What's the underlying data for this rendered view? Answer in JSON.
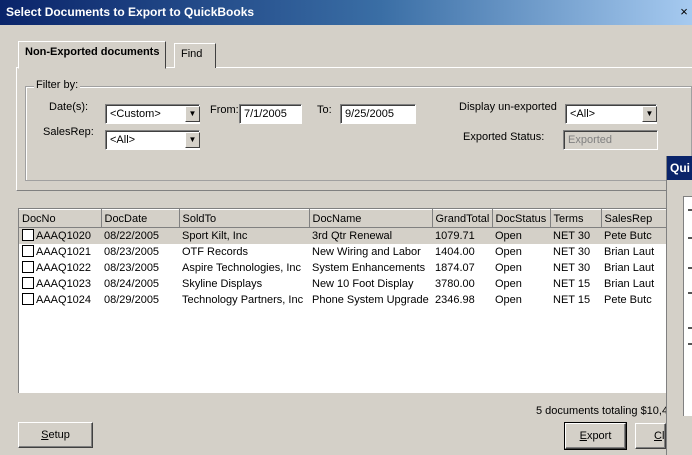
{
  "window": {
    "title": "Select Documents to Export to QuickBooks",
    "close_glyph": "×"
  },
  "tabs": [
    {
      "label": "Non-Exported documents",
      "active": true
    },
    {
      "label": "Find",
      "active": false
    }
  ],
  "filter": {
    "legend": "Filter by:",
    "dates_label": "Date(s):",
    "dates_value": "<Custom>",
    "from_label": "From:",
    "from_value": "7/1/2005",
    "to_label": "To:",
    "to_value": "9/25/2005",
    "salesrep_label": "SalesRep:",
    "salesrep_value": "<All>",
    "display_label": "Display un-exported",
    "display_value": "<All>",
    "status_label": "Exported Status:",
    "status_value": "Exported"
  },
  "table": {
    "columns": [
      "DocNo",
      "DocDate",
      "SoldTo",
      "DocName",
      "GrandTotal",
      "DocStatus",
      "Terms",
      "SalesRep"
    ],
    "rows": [
      {
        "docno": "AAAQ1020",
        "date": "08/22/2005",
        "soldto": "Sport Kilt, Inc",
        "docname": "3rd Qtr Renewal",
        "total": "1079.71",
        "status": "Open",
        "terms": "NET 30",
        "rep": "Pete Butc",
        "checked": false,
        "selected": true
      },
      {
        "docno": "AAAQ1021",
        "date": "08/23/2005",
        "soldto": "OTF Records",
        "docname": "New Wiring and Labor",
        "total": "1404.00",
        "status": "Open",
        "terms": "NET 30",
        "rep": "Brian Laut",
        "checked": false,
        "selected": false
      },
      {
        "docno": "AAAQ1022",
        "date": "08/23/2005",
        "soldto": "Aspire Technologies, Inc",
        "docname": "System Enhancements",
        "total": "1874.07",
        "status": "Open",
        "terms": "NET 30",
        "rep": "Brian Laut",
        "checked": false,
        "selected": false
      },
      {
        "docno": "AAAQ1023",
        "date": "08/24/2005",
        "soldto": "Skyline Displays",
        "docname": "New 10 Foot Display",
        "total": "3780.00",
        "status": "Open",
        "terms": "NET 15",
        "rep": "Brian Laut",
        "checked": false,
        "selected": false
      },
      {
        "docno": "AAAQ1024",
        "date": "08/29/2005",
        "soldto": "Technology Partners, Inc",
        "docname": "Phone System Upgrade",
        "total": "2346.98",
        "status": "Open",
        "terms": "NET 15",
        "rep": "Pete Butc",
        "checked": false,
        "selected": false
      }
    ]
  },
  "summary": "5 documents totaling $10,4",
  "buttons": {
    "setup_mnemonic": "S",
    "setup_rest": "etup",
    "export_mnemonic": "E",
    "export_rest": "xport",
    "close_mnemonic": "C",
    "close_rest": "l"
  },
  "overlay": {
    "title": "Qui"
  },
  "colors": {
    "title_start": "#0a246a",
    "title_end": "#a6caf0",
    "selected_row": "#d4d0c8",
    "window_bg": "#d4d0c8"
  }
}
